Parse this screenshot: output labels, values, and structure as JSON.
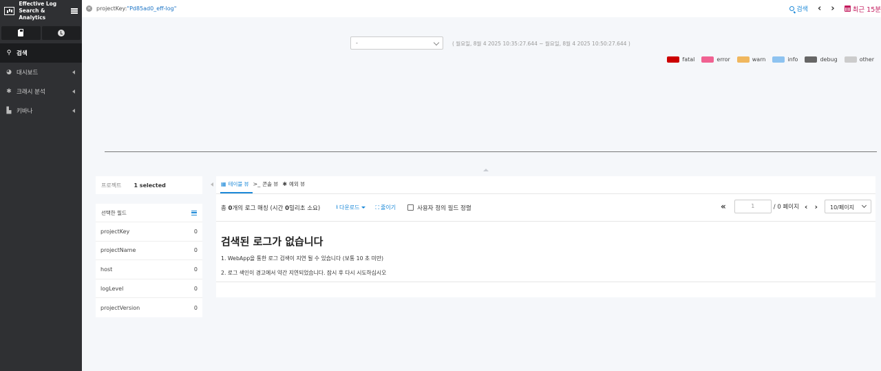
{
  "app": {
    "brand_line1": "Effective Log",
    "brand_line2": "Search & Analytics"
  },
  "sidebar": {
    "items": [
      {
        "icon": "search-icon",
        "label": "검색",
        "active": true
      },
      {
        "icon": "dashboard-icon",
        "label": "대시보드"
      },
      {
        "icon": "bug-icon",
        "label": "크래시 분석"
      },
      {
        "icon": "factory-icon",
        "label": "키바나"
      }
    ]
  },
  "topbar": {
    "query_key": "projectKey:",
    "query_value": "\"Pd85ad0_eff-log\"",
    "search_label": "검색",
    "time_label": "최근 15분"
  },
  "histogram": {
    "interval_value": "-",
    "range_text": "( 월요일, 8월 4 2025 10:35:27.644 ~ 월요일, 8월 4 2025 10:50:27.644 )",
    "legend": [
      {
        "label": "fatal",
        "color": "#cc0000"
      },
      {
        "label": "error",
        "color": "#f06292"
      },
      {
        "label": "warn",
        "color": "#f0b75e"
      },
      {
        "label": "info",
        "color": "#8ec3f0"
      },
      {
        "label": "debug",
        "color": "#666666"
      },
      {
        "label": "other",
        "color": "#cccccc"
      }
    ]
  },
  "project": {
    "label": "프로젝트",
    "selected": "1 selected"
  },
  "fields": {
    "title": "선택한 필드",
    "rows": [
      {
        "name": "projectKey",
        "count": "0"
      },
      {
        "name": "projectName",
        "count": "0"
      },
      {
        "name": "host",
        "count": "0"
      },
      {
        "name": "logLevel",
        "count": "0"
      },
      {
        "name": "projectVersion",
        "count": "0"
      }
    ]
  },
  "main": {
    "tabs": [
      {
        "label": "테이블 뷰",
        "icon": "▦"
      },
      {
        "label": "콘솔 뷰",
        "icon": ">_"
      },
      {
        "label": "예외 뷰",
        "icon": "✱"
      }
    ],
    "total_prefix": "총 ",
    "total_count": "0",
    "total_mid": "개의 로그 매칭 (시간 ",
    "total_ms": "0",
    "total_suffix": "밀리초 소요)",
    "download_label": "다운로드",
    "wrap_label": "줄이기",
    "custom_sort_label": "사용자 정의 필드 정렬",
    "page_input_value": "1",
    "page_total": "/ 0 페이지",
    "page_size": "10/페이지",
    "empty_title": "검색된 로그가 없습니다",
    "empty_line1": "1. WebApp을 통한 로그 검색이 지연 될 수 있습니다 (보통 10 초 미만)",
    "empty_line2": "2. 로그 색인이 경고에서 약간 지연되었습니다. 잠시 후 다시 시도하십시오"
  }
}
